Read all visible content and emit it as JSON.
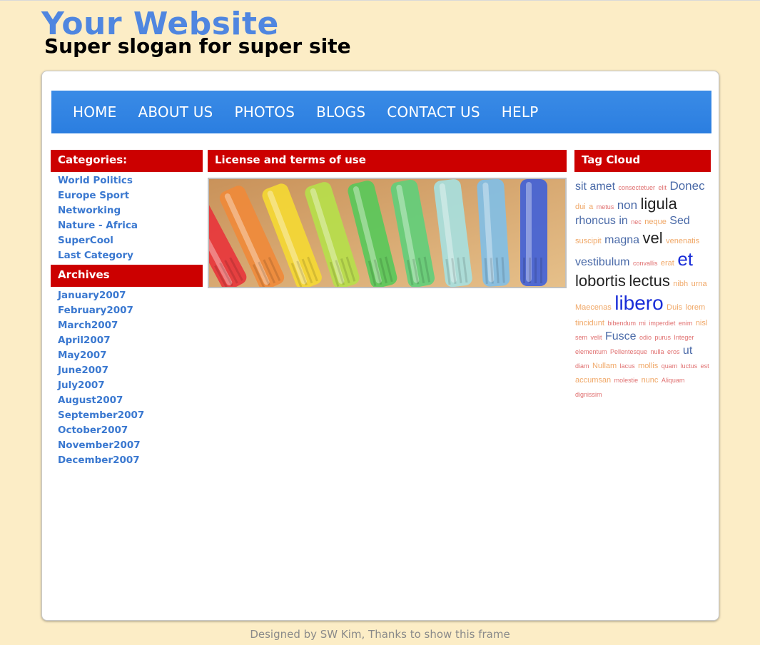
{
  "header": {
    "site_title": "Your Website",
    "slogan": "Super slogan for super site"
  },
  "nav": [
    "HOME",
    "ABOUT US",
    "PHOTOS",
    "BLOGS",
    "CONTACT US",
    "HELP"
  ],
  "categories": {
    "heading": "Categories:",
    "items": [
      "World Politics",
      "Europe Sport",
      "Networking",
      "Nature - Africa",
      "SuperCool",
      "Last Category"
    ]
  },
  "archives": {
    "heading": "Archives",
    "items": [
      "January2007",
      "February2007",
      "March2007",
      "April2007",
      "May2007",
      "June2007",
      "July2007",
      "August2007",
      "September2007",
      "October2007",
      "November2007",
      "December2007"
    ]
  },
  "main": {
    "heading": "License and terms of use"
  },
  "tag_cloud": {
    "heading": "Tag Cloud",
    "tags": [
      {
        "t": "sit",
        "s": 16,
        "c": "#4a6aa8"
      },
      {
        "t": "amet",
        "s": 16,
        "c": "#4a6aa8"
      },
      {
        "t": "consectetuer",
        "s": 9,
        "c": "#e07070"
      },
      {
        "t": "elit",
        "s": 9,
        "c": "#e07070"
      },
      {
        "t": "Donec",
        "s": 17,
        "c": "#4a6aa8"
      },
      {
        "t": "dui",
        "s": 11,
        "c": "#f0a868"
      },
      {
        "t": "a",
        "s": 11,
        "c": "#f0a868"
      },
      {
        "t": "metus",
        "s": 9,
        "c": "#e07070"
      },
      {
        "t": "non",
        "s": 17,
        "c": "#4a6aa8"
      },
      {
        "t": "ligula",
        "s": 22,
        "c": "#222222"
      },
      {
        "t": "rhoncus",
        "s": 16,
        "c": "#4a6aa8"
      },
      {
        "t": "in",
        "s": 16,
        "c": "#4a6aa8"
      },
      {
        "t": "nec",
        "s": 9,
        "c": "#e07070"
      },
      {
        "t": "neque",
        "s": 11,
        "c": "#f0a868"
      },
      {
        "t": "Sed",
        "s": 16,
        "c": "#4a6aa8"
      },
      {
        "t": "suscipit",
        "s": 11,
        "c": "#f0a868"
      },
      {
        "t": "magna",
        "s": 16,
        "c": "#4a6aa8"
      },
      {
        "t": "vel",
        "s": 22,
        "c": "#222222"
      },
      {
        "t": "venenatis",
        "s": 11,
        "c": "#f0a868"
      },
      {
        "t": "vestibulum",
        "s": 16,
        "c": "#4a6aa8"
      },
      {
        "t": "convallis",
        "s": 9,
        "c": "#e07070"
      },
      {
        "t": "erat",
        "s": 11,
        "c": "#f0a868"
      },
      {
        "t": "et",
        "s": 26,
        "c": "#1a2ed8"
      },
      {
        "t": "lobortis",
        "s": 22,
        "c": "#222222"
      },
      {
        "t": "lectus",
        "s": 22,
        "c": "#222222"
      },
      {
        "t": "nibh",
        "s": 11,
        "c": "#f0a868"
      },
      {
        "t": "urna",
        "s": 11,
        "c": "#f0a868"
      },
      {
        "t": "Maecenas",
        "s": 11,
        "c": "#f0a868"
      },
      {
        "t": "libero",
        "s": 28,
        "c": "#1a2ed8"
      },
      {
        "t": "Duis",
        "s": 11,
        "c": "#f0a868"
      },
      {
        "t": "lorem",
        "s": 11,
        "c": "#f0a868"
      },
      {
        "t": "tincidunt",
        "s": 11,
        "c": "#f0a868"
      },
      {
        "t": "bibendum",
        "s": 9,
        "c": "#e07070"
      },
      {
        "t": "mi",
        "s": 9,
        "c": "#e07070"
      },
      {
        "t": "imperdiet",
        "s": 9,
        "c": "#e07070"
      },
      {
        "t": "enim",
        "s": 9,
        "c": "#e07070"
      },
      {
        "t": "nisl",
        "s": 11,
        "c": "#f0a868"
      },
      {
        "t": "sem",
        "s": 9,
        "c": "#e07070"
      },
      {
        "t": "velit",
        "s": 9,
        "c": "#e07070"
      },
      {
        "t": "Fusce",
        "s": 16,
        "c": "#4a6aa8"
      },
      {
        "t": "odio",
        "s": 9,
        "c": "#e07070"
      },
      {
        "t": "purus",
        "s": 9,
        "c": "#e07070"
      },
      {
        "t": "Integer",
        "s": 9,
        "c": "#e07070"
      },
      {
        "t": "elementum",
        "s": 9,
        "c": "#e07070"
      },
      {
        "t": "Pellentesque",
        "s": 9,
        "c": "#e07070"
      },
      {
        "t": "nulla",
        "s": 9,
        "c": "#e07070"
      },
      {
        "t": "eros",
        "s": 9,
        "c": "#e07070"
      },
      {
        "t": "ut",
        "s": 16,
        "c": "#4a6aa8"
      },
      {
        "t": "diam",
        "s": 9,
        "c": "#e07070"
      },
      {
        "t": "Nullam",
        "s": 11,
        "c": "#f0a868"
      },
      {
        "t": "lacus",
        "s": 9,
        "c": "#e07070"
      },
      {
        "t": "mollis",
        "s": 11,
        "c": "#f0a868"
      },
      {
        "t": "quam",
        "s": 9,
        "c": "#e07070"
      },
      {
        "t": "luctus",
        "s": 9,
        "c": "#e07070"
      },
      {
        "t": "est",
        "s": 9,
        "c": "#e07070"
      },
      {
        "t": "accumsan",
        "s": 11,
        "c": "#f0a868"
      },
      {
        "t": "molestie",
        "s": 9,
        "c": "#e07070"
      },
      {
        "t": "nunc",
        "s": 11,
        "c": "#f0a868"
      },
      {
        "t": "Aliquam",
        "s": 9,
        "c": "#e07070"
      },
      {
        "t": "dignissim",
        "s": 9,
        "c": "#e07070"
      }
    ]
  },
  "footer": {
    "text": "Designed by SW Kim, Thanks to show this frame"
  },
  "colors": {
    "page_bg": "#fcedc6",
    "title_blue": "#4f86e0",
    "nav_blue": "#3a8be6",
    "header_red": "#cc0000",
    "link_blue": "#3a78d0"
  },
  "image": {
    "description_icon": "colored-markers-photo",
    "marker_colors": [
      "#e8343b",
      "#f08a3a",
      "#f5d933",
      "#b6e04a",
      "#56c95a",
      "#5fcf7a",
      "#a6e0e0",
      "#7fbfe8",
      "#3f5fd8"
    ]
  }
}
